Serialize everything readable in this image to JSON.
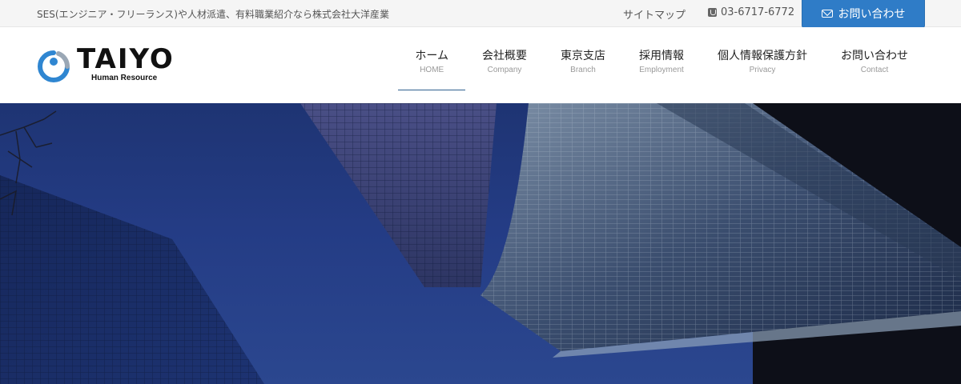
{
  "topbar": {
    "tagline": "SES(エンジニア・フリーランス)や人材派遣、有料職業紹介なら株式会社大洋産業",
    "sitemap_label": "サイトマップ",
    "phone": "03-6717-6772",
    "contact_button_label": "お問い合わせ"
  },
  "logo": {
    "name": "TAIYO",
    "sub": "Human Resource"
  },
  "nav": {
    "items": [
      {
        "jp": "ホーム",
        "en": "HOME"
      },
      {
        "jp": "会社概要",
        "en": "Company"
      },
      {
        "jp": "東京支店",
        "en": "Branch"
      },
      {
        "jp": "採用情報",
        "en": "Employment"
      },
      {
        "jp": "個人情報保護方針",
        "en": "Privacy"
      },
      {
        "jp": "お問い合わせ",
        "en": "Contact"
      }
    ]
  },
  "colors": {
    "accent": "#2f7cc7",
    "hero_sky": "#243c85"
  }
}
